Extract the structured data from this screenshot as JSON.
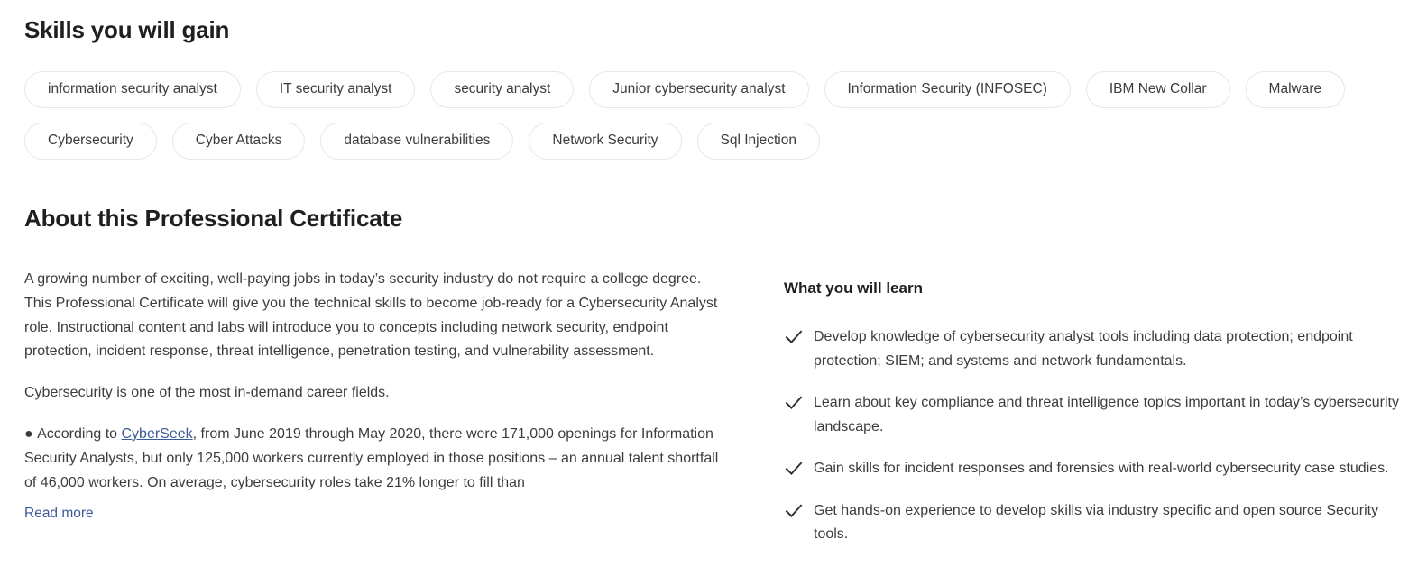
{
  "skills": {
    "heading": "Skills you will gain",
    "tags": [
      "information security analyst",
      "IT security analyst",
      "security analyst",
      "Junior cybersecurity analyst",
      "Information Security (INFOSEC)",
      "IBM New Collar",
      "Malware",
      "Cybersecurity",
      "Cyber Attacks",
      "database vulnerabilities",
      "Network Security",
      "Sql Injection"
    ]
  },
  "about": {
    "heading": "About this Professional Certificate",
    "paragraph1": "A growing number of exciting, well-paying jobs in today’s security industry do not require a college degree. This Professional Certificate will give you the technical skills to become job-ready for a Cybersecurity Analyst role. Instructional content and labs will introduce you to concepts including network security, endpoint protection, incident response, threat intelligence, penetration testing, and vulnerability assessment.",
    "paragraph2": "Cybersecurity is one of the most in-demand career fields.",
    "bullet_marker": "●",
    "bullet_before_link": "According to ",
    "bullet_link_text": "CyberSeek",
    "bullet_after_link": ", from June 2019  through May 2020, there were 171,000 openings for Information Security Analysts, but only 125,000 workers currently employed in those positions – an annual talent shortfall of 46,000 workers. On average, cybersecurity roles take 21% longer to fill than",
    "read_more_label": "Read more"
  },
  "learn": {
    "heading": "What you will learn",
    "items": [
      "Develop knowledge of cybersecurity analyst tools including data protection; endpoint protection; SIEM; and systems and network fundamentals.",
      "Learn about key compliance and threat intelligence topics important in today’s cybersecurity landscape.",
      "Gain skills for incident responses and forensics with real-world cybersecurity case studies.",
      "Get hands-on experience to develop skills via industry specific and open source Security tools."
    ],
    "check_icon": "check-icon"
  },
  "colors": {
    "text_primary": "#1f1f1f",
    "text_body": "#3c3c3c",
    "link": "#3c5a99",
    "pill_border": "#e5e7e9",
    "background": "#ffffff"
  }
}
